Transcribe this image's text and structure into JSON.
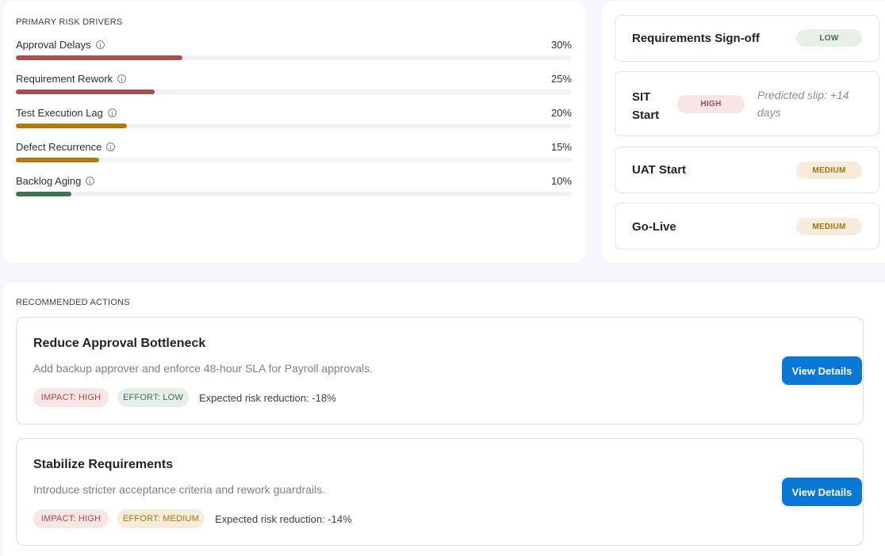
{
  "drivers": {
    "title": "PRIMARY RISK DRIVERS",
    "items": [
      {
        "label": "Approval Delays",
        "pct": "30%",
        "value": 0.3,
        "color": "#a6504f"
      },
      {
        "label": "Requirement Rework",
        "pct": "25%",
        "value": 0.25,
        "color": "#a6504f"
      },
      {
        "label": "Test Execution Lag",
        "pct": "20%",
        "value": 0.2,
        "color": "#b07a0a"
      },
      {
        "label": "Defect Recurrence",
        "pct": "15%",
        "value": 0.15,
        "color": "#b07a0a"
      },
      {
        "label": "Backlog Aging",
        "pct": "10%",
        "value": 0.1,
        "color": "#3e7450"
      }
    ]
  },
  "milestones": [
    {
      "name": "Requirements Sign-off",
      "badge": "LOW"
    },
    {
      "name": "SIT Start",
      "badge": "HIGH",
      "note": "Predicted slip: +14 days"
    },
    {
      "name": "UAT Start",
      "badge": "MEDIUM"
    },
    {
      "name": "Go-Live",
      "badge": "MEDIUM"
    }
  ],
  "actions": {
    "title": "RECOMMENDED ACTIONS",
    "items": [
      {
        "title": "Reduce Approval Bottleneck",
        "description": "Add backup approver and enforce 48-hour SLA for Payroll approvals.",
        "impact": "IMPACT: HIGH",
        "effort": "EFFORT: LOW",
        "reduction": "Expected risk reduction: -18%",
        "button": "View Details"
      },
      {
        "title": "Stabilize Requirements",
        "description": "Introduce stricter acceptance criteria and rework guardrails.",
        "impact": "IMPACT: HIGH",
        "effort": "EFFORT: MEDIUM",
        "reduction": "Expected risk reduction: -14%",
        "button": "View Details"
      }
    ]
  },
  "colors": {
    "high": "#a6484a",
    "medium": "#a9720b",
    "low": "#3e6f48",
    "primary_button": "#0a78d6"
  }
}
